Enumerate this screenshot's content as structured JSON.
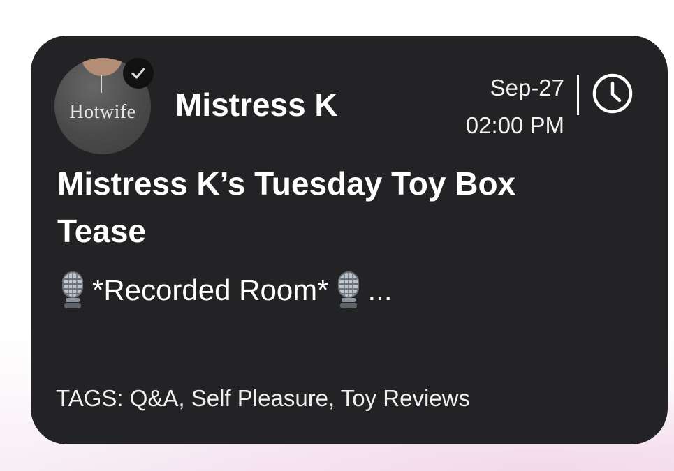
{
  "event_card": {
    "host": {
      "name": "Mistress K",
      "avatar_text": "Hotwife",
      "verified": true
    },
    "date": "Sep-27",
    "time": "02:00 PM",
    "title": "Mistress K’s Tuesday Toy Box Tease",
    "subtitle": "*Recorded Room*",
    "subtitle_ellipsis": "...",
    "tags_text": "TAGS: Q&A, Self Pleasure, Toy Reviews",
    "icons": {
      "verified": "checkmark-badge-icon",
      "clock": "clock-icon",
      "mic": "microphone-icon"
    },
    "colors": {
      "card_background": "#232325",
      "text": "#ffffff",
      "page_background": "#ffffff"
    }
  }
}
